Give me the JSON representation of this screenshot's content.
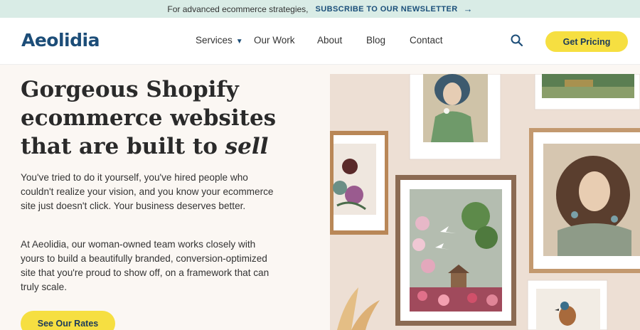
{
  "announcement": {
    "message": "For advanced ecommerce strategies,",
    "link_label": "SUBSCRIBE TO OUR NEWSLETTER",
    "arrow_icon": "arrow-right-icon"
  },
  "header": {
    "logo": "Aeolidia",
    "nav": [
      {
        "label": "Services",
        "icon": "caret-down-icon"
      },
      {
        "label": "Our Work"
      },
      {
        "label": "About"
      },
      {
        "label": "Blog"
      },
      {
        "label": "Contact"
      }
    ],
    "search_icon": "search-icon",
    "cta_label": "Get Pricing"
  },
  "hero": {
    "title_line1": "Gorgeous Shopify",
    "title_line2": "ecommerce websites",
    "title_line3_prefix": "that are built to ",
    "title_line3_emphasis": "sell",
    "paragraph1": "You've tried to do it yourself, you've hired people who couldn't realize your vision, and you know your ecommerce site just doesn't click. Your business deserves better.",
    "paragraph2": "At Aeolidia, our woman-owned team works closely with yours to build a beautifully branded, conversion-optimized site that you're proud to show off, on a framework that can truly scale.",
    "button_label": "See Our Rates"
  },
  "colors": {
    "accent_yellow": "#f6df41",
    "brand_blue": "#1c4d78",
    "banner_mint": "#d9ece6",
    "page_cream": "#fbf7f3"
  }
}
